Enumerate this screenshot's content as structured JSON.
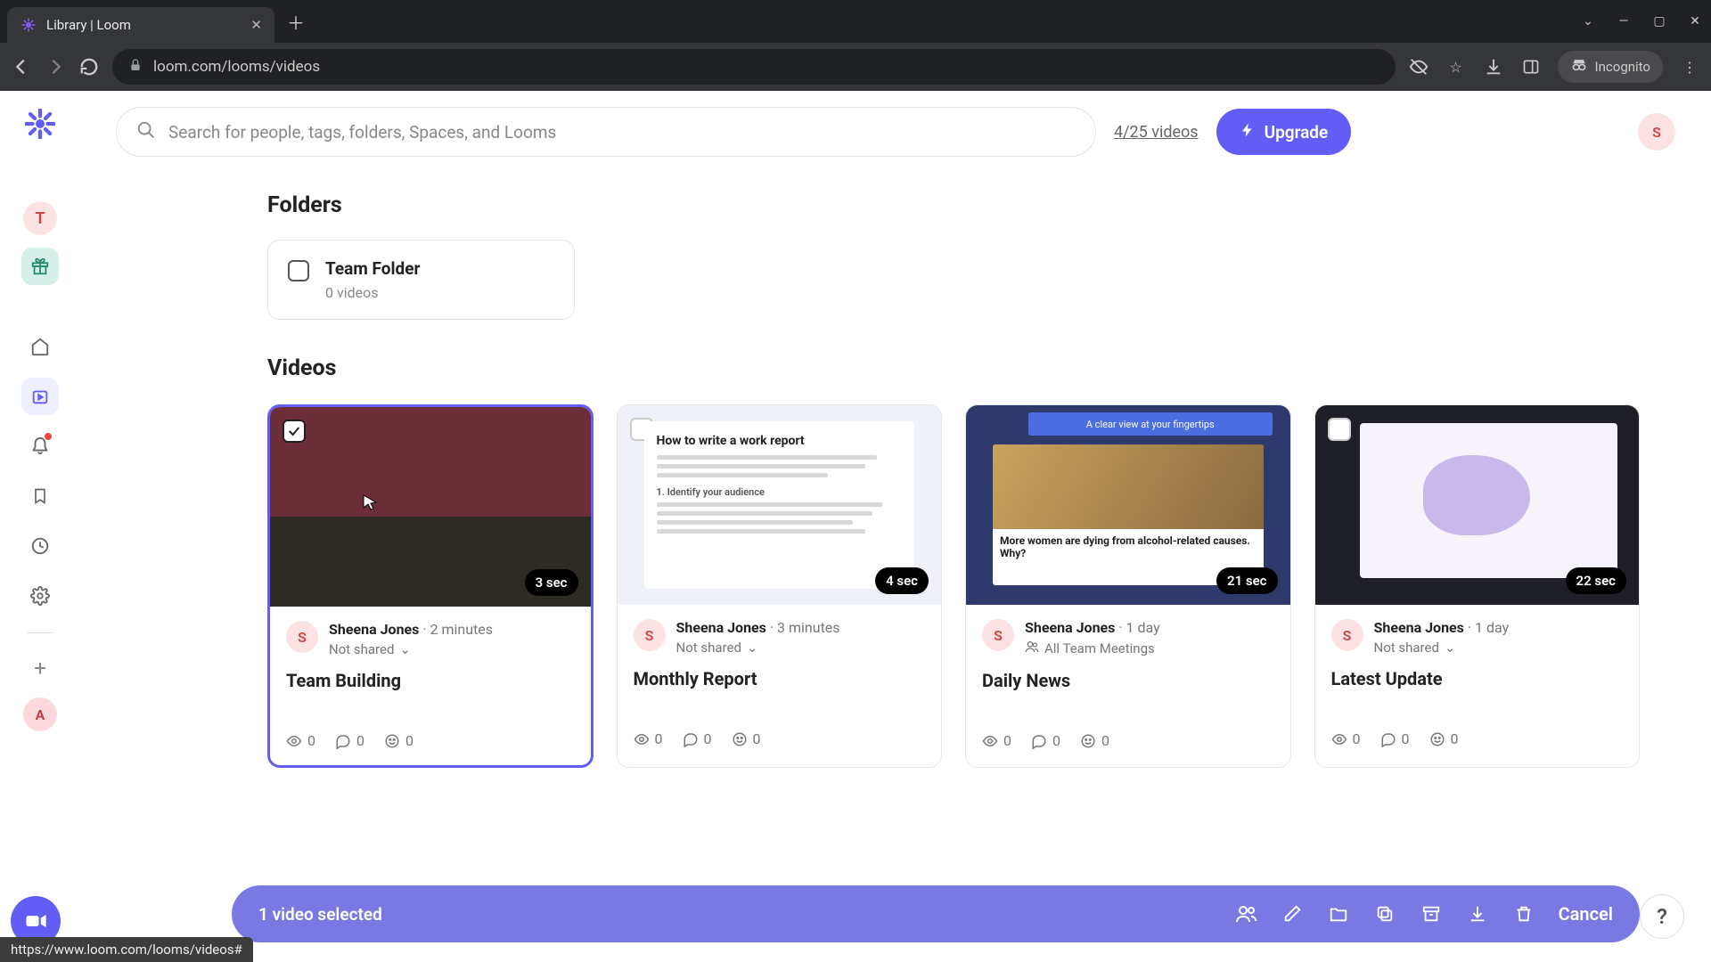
{
  "browser": {
    "tab_title": "Library | Loom",
    "url": "loom.com/looms/videos",
    "incognito_label": "Incognito",
    "status_link": "https://www.loom.com/looms/videos#"
  },
  "header": {
    "search_placeholder": "Search for people, tags, folders, Spaces, and Looms",
    "quota": "4/25 videos",
    "upgrade": "Upgrade",
    "avatar_letter": "S"
  },
  "sidebar": {
    "workspace_letter": "T",
    "bottom_letter": "A"
  },
  "sections": {
    "folders": "Folders",
    "videos": "Videos"
  },
  "folder": {
    "name": "Team Folder",
    "sub": "0 videos"
  },
  "videos": [
    {
      "title": "Team Building",
      "author": "Sheena Jones",
      "time": "2 minutes",
      "share": "Not shared",
      "duration": "3 sec",
      "views": "0",
      "comments": "0",
      "reactions": "0",
      "selected": true
    },
    {
      "title": "Monthly Report",
      "author": "Sheena Jones",
      "time": "3 minutes",
      "share": "Not shared",
      "duration": "4 sec",
      "views": "0",
      "comments": "0",
      "reactions": "0",
      "selected": false,
      "doc_heading": "How to write a work report",
      "doc_sub": "1. Identify your audience"
    },
    {
      "title": "Daily News",
      "author": "Sheena Jones",
      "time": "1 day",
      "share": "All Team Meetings",
      "share_icon": "team",
      "duration": "21 sec",
      "views": "0",
      "comments": "0",
      "reactions": "0",
      "selected": false,
      "banner": "A clear view at your fingertips",
      "headline": "More women are dying from alcohol-related causes. Why?"
    },
    {
      "title": "Latest Update",
      "author": "Sheena Jones",
      "time": "1 day",
      "share": "Not shared",
      "duration": "22 sec",
      "views": "0",
      "comments": "0",
      "reactions": "0",
      "selected": false
    }
  ],
  "selection_bar": {
    "text": "1 video selected",
    "cancel": "Cancel"
  },
  "avatar_initial": "S"
}
